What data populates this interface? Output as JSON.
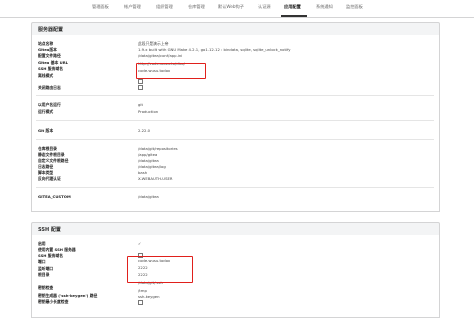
{
  "nav": {
    "tabs": [
      {
        "label": "管理面板"
      },
      {
        "label": "帐户管理"
      },
      {
        "label": "组织管理"
      },
      {
        "label": "仓库管理"
      },
      {
        "label": "默认Web钩子"
      },
      {
        "label": "认证源"
      },
      {
        "label": "应用配置"
      },
      {
        "label": "系统通知"
      },
      {
        "label": "监控面板"
      }
    ],
    "active_index": 6
  },
  "server_config": {
    "title": "服务器配置",
    "rows": [
      {
        "label": "站点名称",
        "value": "此段只是演示上帝"
      },
      {
        "label": "Gitea版本",
        "value": "1.9.x built with GNU Make 4.2.1, go1.12.12 : bindata, sqlite, sqlite_unlock_notify"
      },
      {
        "label": "配置文件路径",
        "value": "/data/gitea/conf/app.ini"
      },
      {
        "label": "Gitea 基本 URL",
        "value": "http://code.wusu.to/diss/"
      },
      {
        "label": "SSH 服务域名",
        "value": "code.wusu.todox"
      },
      {
        "label": "离线模式",
        "value": ""
      },
      {
        "label": "关闭路由日志",
        "value": ""
      },
      {
        "label": "以用户名运行",
        "value": "git"
      },
      {
        "label": "运行模式",
        "value": "Production"
      },
      {
        "label": "Git 版本",
        "value": "2.22.0"
      },
      {
        "label": "仓库根目录",
        "value": "/data/git/repositories"
      },
      {
        "label": "静态文件根目录",
        "value": "/app/gitea"
      },
      {
        "label": "自定义文件根路径",
        "value": "/data/gitea"
      },
      {
        "label": "日志路径",
        "value": "/data/gitea/log"
      },
      {
        "label": "脚本类型",
        "value": "bash"
      },
      {
        "label": "反向代理认证",
        "value": "X-WEBAUTH-USER"
      },
      {
        "label": "GITEA_CUSTOM",
        "value": "/data/gitea"
      }
    ]
  },
  "ssh_config": {
    "title": "SSH 配置",
    "rows": [
      {
        "label": "启用",
        "value": "✓"
      },
      {
        "label": "使用内置 SSH 服务器",
        "value": ""
      },
      {
        "label": "SSH 服务域名",
        "value": "code.wusu.todox"
      },
      {
        "label": "端口",
        "value": "2222"
      },
      {
        "label": "监听端口",
        "value": "2222"
      },
      {
        "label": "根目录",
        "value": "/data/git/.ssh"
      },
      {
        "label": "密钥检查",
        "value": ""
      },
      {
        "label": "密钥生成器 ('ssh-keygen') 路径",
        "value": "ssh-keygen"
      },
      {
        "label": "密钥最小长度检查",
        "value": ""
      }
    ]
  },
  "colors": {
    "highlight": "#e0201c",
    "panel_header_bg": "#f3f4f5",
    "border": "#d4d4d5"
  }
}
